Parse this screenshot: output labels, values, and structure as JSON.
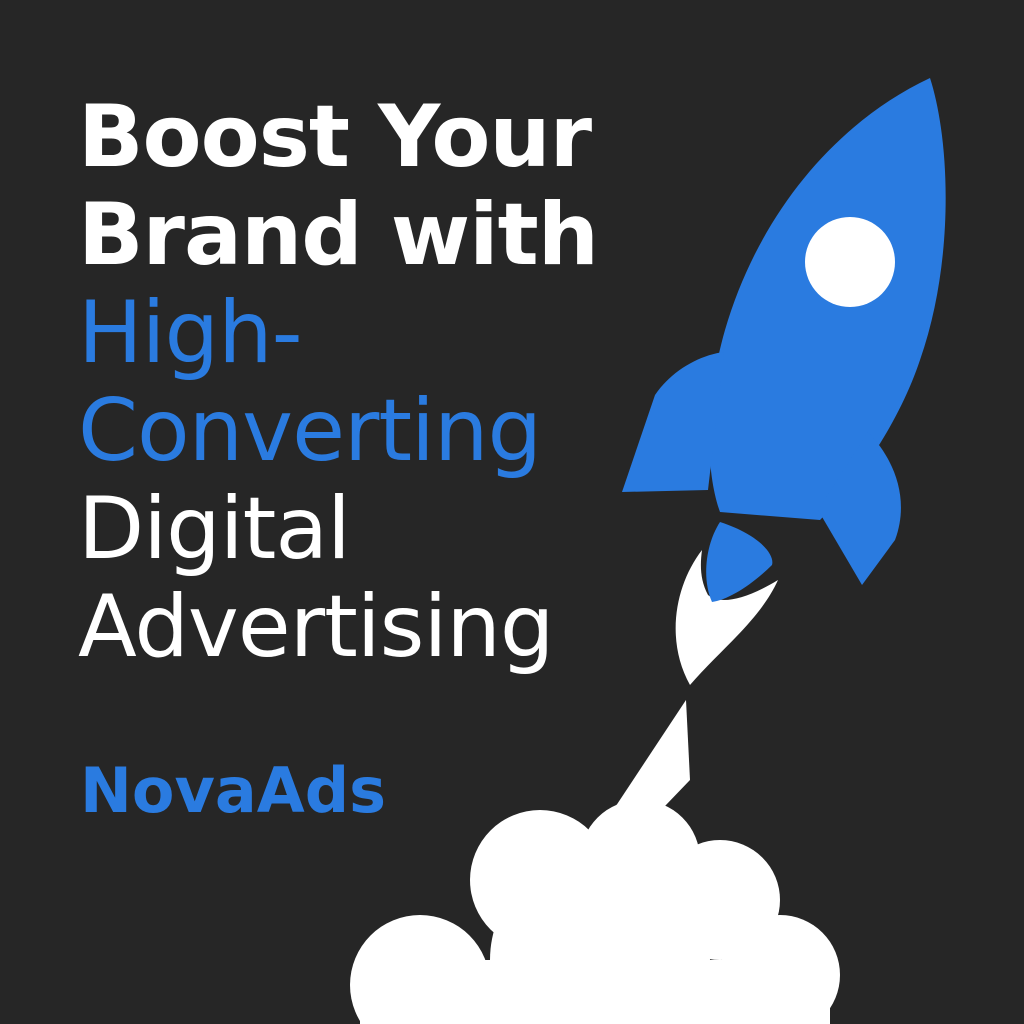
{
  "headline": {
    "line1": "Boost Your",
    "line2": "Brand with",
    "line3": "High-",
    "line4": "Converting",
    "line5": "Digital",
    "line6": "Advertising"
  },
  "brand": {
    "name": "NovaAds"
  },
  "colors": {
    "background": "#262626",
    "accent": "#2a7be0",
    "text": "#ffffff"
  },
  "icons": {
    "rocket": "rocket-icon",
    "smoke": "smoke-cloud-icon",
    "window": "porthole-icon",
    "exhaust": "exhaust-flame-icon"
  }
}
